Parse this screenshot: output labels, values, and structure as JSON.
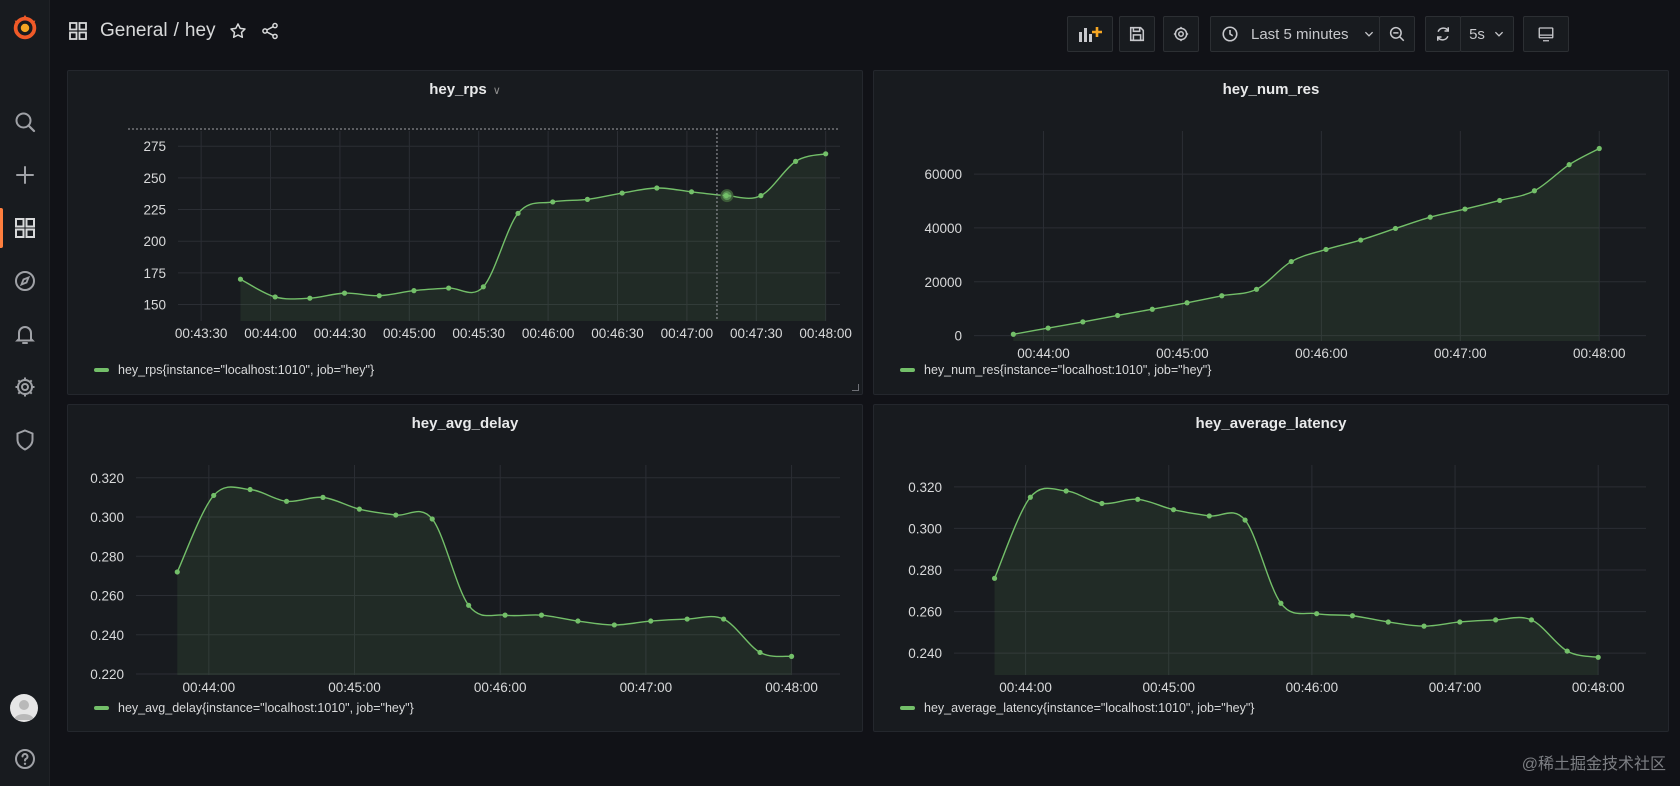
{
  "breadcrumb": {
    "folder": "General",
    "separator": "/",
    "dashboard": "hey"
  },
  "toolbar": {
    "time_range": "Last 5 minutes",
    "refresh": "5s"
  },
  "icons": {
    "logo": "grafana-logo-icon",
    "search": "search-icon",
    "create": "plus-icon",
    "dashboards": "dashboards-icon",
    "explore": "compass-icon",
    "alerting": "bell-icon",
    "config": "gear-icon",
    "admin": "shield-icon",
    "help": "help-icon"
  },
  "colors": {
    "accent": "#ff7f3e",
    "series": "#73bf69"
  },
  "watermark": "@稀土掘金技术社区",
  "panels": [
    {
      "title": "hey_rps",
      "has_menu": true,
      "legend": "hey_rps{instance=\"localhost:1010\", job=\"hey\"}",
      "chart_data": {
        "type": "line",
        "x_ticks": [
          "00:43:30",
          "00:44:00",
          "00:44:30",
          "00:45:00",
          "00:45:30",
          "00:46:00",
          "00:46:30",
          "00:47:00",
          "00:47:30",
          "00:48:00"
        ],
        "y_ticks": [
          275,
          250,
          225,
          200,
          175,
          150
        ],
        "ylim": [
          137,
          287
        ],
        "x": [
          "00:43:47",
          "00:44:02",
          "00:44:17",
          "00:44:32",
          "00:44:47",
          "00:45:02",
          "00:45:17",
          "00:45:32",
          "00:45:47",
          "00:46:02",
          "00:46:17",
          "00:46:32",
          "00:46:47",
          "00:47:02",
          "00:47:17",
          "00:47:32",
          "00:47:47",
          "00:48:00"
        ],
        "series": [
          {
            "name": "hey_rps{instance=\"localhost:1010\", job=\"hey\"}",
            "values": [
              170,
              156,
              155,
              159,
              157,
              161,
              163,
              164,
              222,
              231,
              233,
              238,
              242,
              239,
              236,
              236,
              263,
              269
            ]
          }
        ],
        "hover": {
          "x": "00:47:13",
          "value": 236
        }
      }
    },
    {
      "title": "hey_num_res",
      "has_menu": false,
      "legend": "hey_num_res{instance=\"localhost:1010\", job=\"hey\"}",
      "chart_data": {
        "type": "line",
        "x_ticks": [
          "00:44:00",
          "00:45:00",
          "00:46:00",
          "00:47:00",
          "00:48:00"
        ],
        "y_ticks": [
          60000,
          40000,
          20000,
          0
        ],
        "ylim": [
          -2000,
          76000
        ],
        "x": [
          "00:43:47",
          "00:44:02",
          "00:44:17",
          "00:44:32",
          "00:44:47",
          "00:45:02",
          "00:45:17",
          "00:45:32",
          "00:45:47",
          "00:46:02",
          "00:46:17",
          "00:46:32",
          "00:46:47",
          "00:47:02",
          "00:47:17",
          "00:47:32",
          "00:47:47",
          "00:48:00"
        ],
        "series": [
          {
            "name": "hey_num_res{instance=\"localhost:1010\", job=\"hey\"}",
            "values": [
              500,
              2800,
              5100,
              7500,
              9800,
              12200,
              14800,
              17200,
              27500,
              32000,
              35500,
              39800,
              44000,
              47000,
              50200,
              53800,
              63500,
              69500
            ]
          }
        ]
      }
    },
    {
      "title": "hey_avg_delay",
      "has_menu": false,
      "legend": "hey_avg_delay{instance=\"localhost:1010\", job=\"hey\"}",
      "chart_data": {
        "type": "line",
        "x_ticks": [
          "00:44:00",
          "00:45:00",
          "00:46:00",
          "00:47:00",
          "00:48:00"
        ],
        "y_ticks": [
          "0.320",
          "0.300",
          "0.280",
          "0.260",
          "0.240",
          "0.220"
        ],
        "ylim": [
          0.2195,
          0.3265
        ],
        "x": [
          "00:43:47",
          "00:44:02",
          "00:44:17",
          "00:44:32",
          "00:44:47",
          "00:45:02",
          "00:45:17",
          "00:45:32",
          "00:45:47",
          "00:46:02",
          "00:46:17",
          "00:46:32",
          "00:46:47",
          "00:47:02",
          "00:47:17",
          "00:47:32",
          "00:47:47",
          "00:48:00"
        ],
        "series": [
          {
            "name": "hey_avg_delay{instance=\"localhost:1010\", job=\"hey\"}",
            "values": [
              0.272,
              0.311,
              0.314,
              0.308,
              0.31,
              0.304,
              0.301,
              0.299,
              0.255,
              0.25,
              0.25,
              0.247,
              0.245,
              0.247,
              0.248,
              0.248,
              0.231,
              0.229
            ]
          }
        ]
      }
    },
    {
      "title": "hey_average_latency",
      "has_menu": false,
      "legend": "hey_average_latency{instance=\"localhost:1010\", job=\"hey\"}",
      "chart_data": {
        "type": "line",
        "x_ticks": [
          "00:44:00",
          "00:45:00",
          "00:46:00",
          "00:47:00",
          "00:48:00"
        ],
        "y_ticks": [
          "0.320",
          "0.300",
          "0.280",
          "0.260",
          "0.240"
        ],
        "ylim": [
          0.2295,
          0.3305
        ],
        "x": [
          "00:43:47",
          "00:44:02",
          "00:44:17",
          "00:44:32",
          "00:44:47",
          "00:45:02",
          "00:45:17",
          "00:45:32",
          "00:45:47",
          "00:46:02",
          "00:46:17",
          "00:46:32",
          "00:46:47",
          "00:47:02",
          "00:47:17",
          "00:47:32",
          "00:47:47",
          "00:48:00"
        ],
        "series": [
          {
            "name": "hey_average_latency{instance=\"localhost:1010\", job=\"hey\"}",
            "values": [
              0.276,
              0.315,
              0.318,
              0.312,
              0.314,
              0.309,
              0.306,
              0.304,
              0.264,
              0.259,
              0.258,
              0.255,
              0.253,
              0.255,
              0.256,
              0.256,
              0.241,
              0.238
            ]
          }
        ]
      }
    }
  ]
}
